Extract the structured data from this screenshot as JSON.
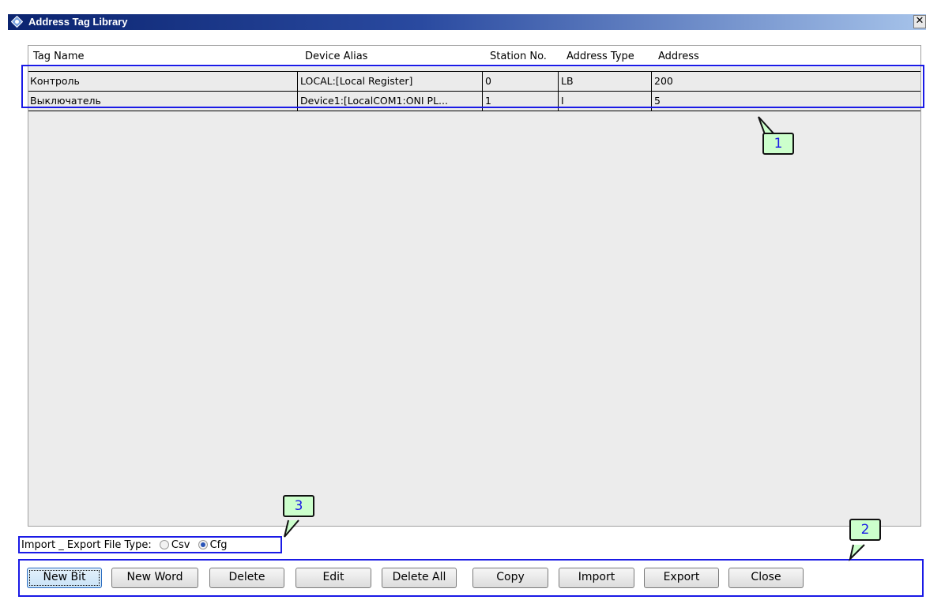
{
  "window": {
    "title": "Address Tag Library",
    "close_label": "✕"
  },
  "table": {
    "headers": [
      "Tag Name",
      "Device Alias",
      "Station No.",
      "Address Type",
      "Address"
    ],
    "rows": [
      [
        "Контроль",
        "LOCAL:[Local Register]",
        "0",
        "LB",
        "200"
      ],
      [
        "Выключатель",
        "Device1:[LocalCOM1:ONI PL...",
        "1",
        "I",
        "5"
      ]
    ]
  },
  "file_type": {
    "label": "Import _ Export File Type:",
    "options": [
      "Csv",
      "Cfg"
    ],
    "selected": "Cfg"
  },
  "buttons": [
    "New Bit",
    "New Word",
    "Delete",
    "Edit",
    "Delete All",
    "Copy",
    "Import",
    "Export",
    "Close"
  ],
  "callouts": [
    "1",
    "2",
    "3"
  ],
  "colors": {
    "highlight": "#1a1ae6",
    "callout_bg": "#ccffcc",
    "titlebar": "#0b2470"
  }
}
